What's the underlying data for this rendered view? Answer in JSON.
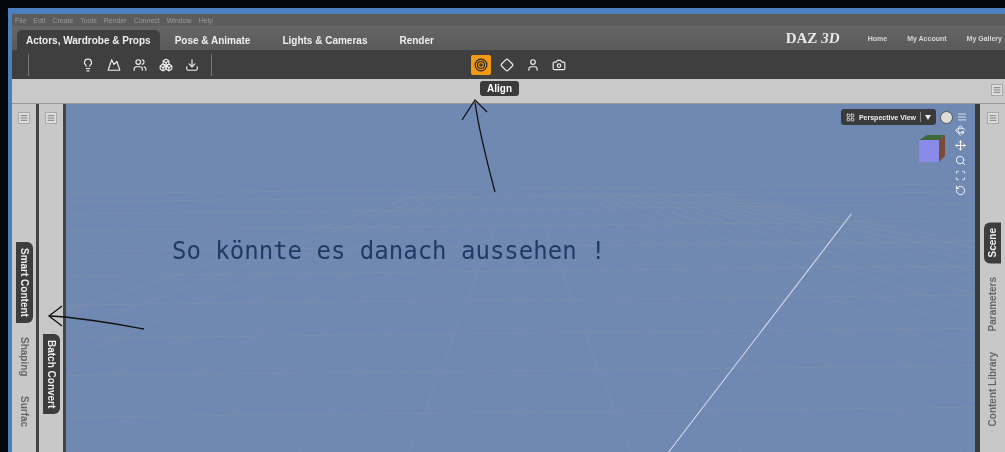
{
  "menu": [
    "File",
    "Edit",
    "Create",
    "Tools",
    "Render",
    "Connect",
    "Window",
    "Help"
  ],
  "tabs": [
    {
      "label": "Actors, Wardrobe & Props",
      "selected": true
    },
    {
      "label": "Pose & Animate",
      "selected": false
    },
    {
      "label": "Lights & Cameras",
      "selected": false
    },
    {
      "label": "Render",
      "selected": false
    }
  ],
  "logo": {
    "left": "DAZ",
    "right": "3D"
  },
  "links": [
    "Home",
    "My Account",
    "My Gallery"
  ],
  "toolbar": {
    "left_tools": [
      {
        "selected": false
      },
      {
        "selected": false
      },
      {
        "selected": false
      },
      {
        "selected": false
      },
      {
        "selected": false
      }
    ],
    "center_tools": [
      {
        "selected": true
      },
      {
        "selected": false
      },
      {
        "selected": false
      },
      {
        "selected": false
      }
    ]
  },
  "tooltip": "Align",
  "left_panels": [
    {
      "tabs": [
        {
          "label": "Smart Content",
          "selected": true
        },
        {
          "label": "Shaping",
          "selected": false
        },
        {
          "label": "Surfac",
          "selected": false
        }
      ]
    },
    {
      "tabs": [
        {
          "label": "Batch Convert",
          "selected": true
        }
      ]
    }
  ],
  "viewport": {
    "view": "Perspective View"
  },
  "right_panel": {
    "tabs": [
      {
        "label": "Scene",
        "selected": true
      },
      {
        "label": "Parameters",
        "selected": false
      },
      {
        "label": "Content Library",
        "selected": false
      }
    ]
  },
  "annotation": "So könnte es danach aussehen !"
}
